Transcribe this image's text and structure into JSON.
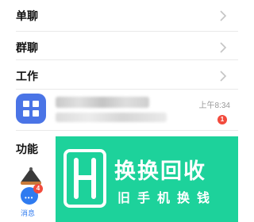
{
  "contacts": {
    "single_chat": "单聊",
    "group_chat": "群聊",
    "work": "工作"
  },
  "chat_item": {
    "time": "上午8:34",
    "unread": "1"
  },
  "features": {
    "title": "功能",
    "messages_label": "消息",
    "messages_badge": "4"
  },
  "ad_banner": {
    "title": "换换回收",
    "slogan": "旧手机换钱",
    "color": "#1dd29b"
  },
  "colors": {
    "accent_blue": "#2f7bf0",
    "avatar_blue": "#4a74e6",
    "badge_red": "#f24b3d"
  }
}
